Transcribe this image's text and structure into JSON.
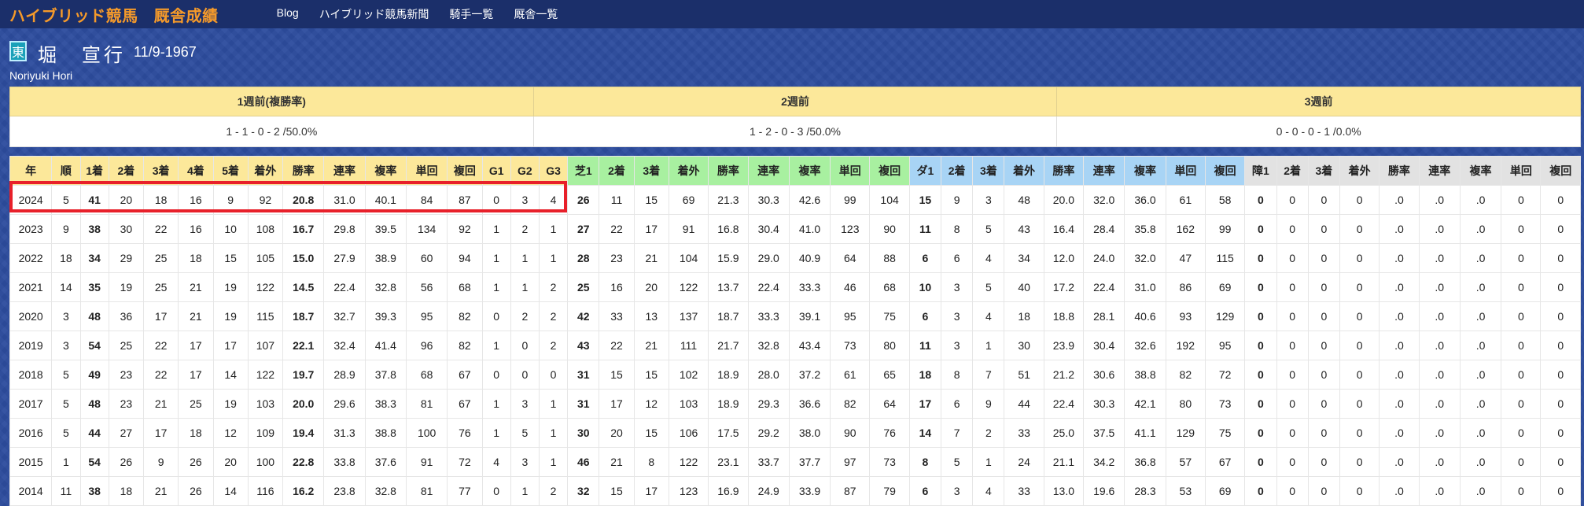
{
  "brand": {
    "site": "ハイブリッド競馬",
    "section": "厩舎成績"
  },
  "nav": [
    "Blog",
    "ハイブリッド競馬新聞",
    "騎手一覧",
    "厩舎一覧"
  ],
  "profile": {
    "affiliation_badge": "東",
    "name": "堀　宣行",
    "birth": "11/9-1967",
    "romaji": "Noriyuki Hori"
  },
  "weeks": {
    "headers": [
      "1週前(複勝率)",
      "2週前",
      "3週前"
    ],
    "values": [
      "1 - 1 - 0 - 2 /50.0%",
      "1 - 2 - 0 - 3 /50.0%",
      "0 - 0 - 0 - 1 /0.0%"
    ]
  },
  "records": {
    "headers": [
      "年",
      "順",
      "1着",
      "2着",
      "3着",
      "4着",
      "5着",
      "着外",
      "勝率",
      "連率",
      "複率",
      "単回",
      "複回",
      "G1",
      "G2",
      "G3",
      "芝1",
      "2着",
      "3着",
      "着外",
      "勝率",
      "連率",
      "複率",
      "単回",
      "複回",
      "ダ1",
      "2着",
      "3着",
      "着外",
      "勝率",
      "連率",
      "複率",
      "単回",
      "複回",
      "障1",
      "2着",
      "3着",
      "着外",
      "勝率",
      "連率",
      "複率",
      "単回",
      "複回"
    ],
    "rows": [
      [
        "2024",
        "5",
        "41",
        "20",
        "18",
        "16",
        "9",
        "92",
        "20.8",
        "31.0",
        "40.1",
        "84",
        "87",
        "0",
        "3",
        "4",
        "26",
        "11",
        "15",
        "69",
        "21.3",
        "30.3",
        "42.6",
        "99",
        "104",
        "15",
        "9",
        "3",
        "48",
        "20.0",
        "32.0",
        "36.0",
        "61",
        "58",
        "0",
        "0",
        "0",
        "0",
        ".0",
        ".0",
        ".0",
        "0",
        "0"
      ],
      [
        "2023",
        "9",
        "38",
        "30",
        "22",
        "16",
        "10",
        "108",
        "16.7",
        "29.8",
        "39.5",
        "134",
        "92",
        "1",
        "2",
        "1",
        "27",
        "22",
        "17",
        "91",
        "16.8",
        "30.4",
        "41.0",
        "123",
        "90",
        "11",
        "8",
        "5",
        "43",
        "16.4",
        "28.4",
        "35.8",
        "162",
        "99",
        "0",
        "0",
        "0",
        "0",
        ".0",
        ".0",
        ".0",
        "0",
        "0"
      ],
      [
        "2022",
        "18",
        "34",
        "29",
        "25",
        "18",
        "15",
        "105",
        "15.0",
        "27.9",
        "38.9",
        "60",
        "94",
        "1",
        "1",
        "1",
        "28",
        "23",
        "21",
        "104",
        "15.9",
        "29.0",
        "40.9",
        "64",
        "88",
        "6",
        "6",
        "4",
        "34",
        "12.0",
        "24.0",
        "32.0",
        "47",
        "115",
        "0",
        "0",
        "0",
        "0",
        ".0",
        ".0",
        ".0",
        "0",
        "0"
      ],
      [
        "2021",
        "14",
        "35",
        "19",
        "25",
        "21",
        "19",
        "122",
        "14.5",
        "22.4",
        "32.8",
        "56",
        "68",
        "1",
        "1",
        "2",
        "25",
        "16",
        "20",
        "122",
        "13.7",
        "22.4",
        "33.3",
        "46",
        "68",
        "10",
        "3",
        "5",
        "40",
        "17.2",
        "22.4",
        "31.0",
        "86",
        "69",
        "0",
        "0",
        "0",
        "0",
        ".0",
        ".0",
        ".0",
        "0",
        "0"
      ],
      [
        "2020",
        "3",
        "48",
        "36",
        "17",
        "21",
        "19",
        "115",
        "18.7",
        "32.7",
        "39.3",
        "95",
        "82",
        "0",
        "2",
        "2",
        "42",
        "33",
        "13",
        "137",
        "18.7",
        "33.3",
        "39.1",
        "95",
        "75",
        "6",
        "3",
        "4",
        "18",
        "18.8",
        "28.1",
        "40.6",
        "93",
        "129",
        "0",
        "0",
        "0",
        "0",
        ".0",
        ".0",
        ".0",
        "0",
        "0"
      ],
      [
        "2019",
        "3",
        "54",
        "25",
        "22",
        "17",
        "17",
        "107",
        "22.1",
        "32.4",
        "41.4",
        "96",
        "82",
        "1",
        "0",
        "2",
        "43",
        "22",
        "21",
        "111",
        "21.7",
        "32.8",
        "43.4",
        "73",
        "80",
        "11",
        "3",
        "1",
        "30",
        "23.9",
        "30.4",
        "32.6",
        "192",
        "95",
        "0",
        "0",
        "0",
        "0",
        ".0",
        ".0",
        ".0",
        "0",
        "0"
      ],
      [
        "2018",
        "5",
        "49",
        "23",
        "22",
        "17",
        "14",
        "122",
        "19.7",
        "28.9",
        "37.8",
        "68",
        "67",
        "0",
        "0",
        "0",
        "31",
        "15",
        "15",
        "102",
        "18.9",
        "28.0",
        "37.2",
        "61",
        "65",
        "18",
        "8",
        "7",
        "51",
        "21.2",
        "30.6",
        "38.8",
        "82",
        "72",
        "0",
        "0",
        "0",
        "0",
        ".0",
        ".0",
        ".0",
        "0",
        "0"
      ],
      [
        "2017",
        "5",
        "48",
        "23",
        "21",
        "25",
        "19",
        "103",
        "20.0",
        "29.6",
        "38.3",
        "81",
        "67",
        "1",
        "3",
        "1",
        "31",
        "17",
        "12",
        "103",
        "18.9",
        "29.3",
        "36.6",
        "82",
        "64",
        "17",
        "6",
        "9",
        "44",
        "22.4",
        "30.3",
        "42.1",
        "80",
        "73",
        "0",
        "0",
        "0",
        "0",
        ".0",
        ".0",
        ".0",
        "0",
        "0"
      ],
      [
        "2016",
        "5",
        "44",
        "27",
        "17",
        "18",
        "12",
        "109",
        "19.4",
        "31.3",
        "38.8",
        "100",
        "76",
        "1",
        "5",
        "1",
        "30",
        "20",
        "15",
        "106",
        "17.5",
        "29.2",
        "38.0",
        "90",
        "76",
        "14",
        "7",
        "2",
        "33",
        "25.0",
        "37.5",
        "41.1",
        "129",
        "75",
        "0",
        "0",
        "0",
        "0",
        ".0",
        ".0",
        ".0",
        "0",
        "0"
      ],
      [
        "2015",
        "1",
        "54",
        "26",
        "9",
        "26",
        "20",
        "100",
        "22.8",
        "33.8",
        "37.6",
        "91",
        "72",
        "4",
        "3",
        "1",
        "46",
        "21",
        "8",
        "122",
        "23.1",
        "33.7",
        "37.7",
        "97",
        "73",
        "8",
        "5",
        "1",
        "24",
        "21.1",
        "34.2",
        "36.8",
        "57",
        "67",
        "0",
        "0",
        "0",
        "0",
        ".0",
        ".0",
        ".0",
        "0",
        "0"
      ],
      [
        "2014",
        "11",
        "38",
        "18",
        "21",
        "26",
        "14",
        "116",
        "16.2",
        "23.8",
        "32.8",
        "81",
        "77",
        "0",
        "1",
        "2",
        "32",
        "15",
        "17",
        "123",
        "16.9",
        "24.9",
        "33.9",
        "87",
        "79",
        "6",
        "3",
        "4",
        "33",
        "13.0",
        "19.6",
        "28.3",
        "53",
        "69",
        "0",
        "0",
        "0",
        "0",
        ".0",
        ".0",
        ".0",
        "0",
        "0"
      ]
    ]
  }
}
